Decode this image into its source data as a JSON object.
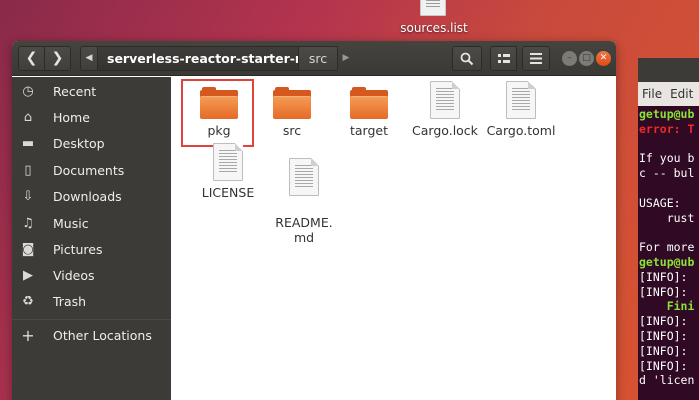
{
  "desktop": {
    "file_label": "sources.list"
  },
  "terminal": {
    "menu": [
      "File",
      "Edit"
    ],
    "lines": [
      {
        "text": "getup@ub",
        "style": "green"
      },
      {
        "text": "error: T",
        "style": "red"
      },
      {
        "text": "",
        "style": ""
      },
      {
        "text": "If you b",
        "style": ""
      },
      {
        "text": "c -- bul",
        "style": ""
      },
      {
        "text": "",
        "style": ""
      },
      {
        "text": "USAGE:",
        "style": ""
      },
      {
        "text": "    rust",
        "style": ""
      },
      {
        "text": "",
        "style": ""
      },
      {
        "text": "For more",
        "style": ""
      },
      {
        "text": "getup@ub",
        "style": "green"
      },
      {
        "text": "[INFO]: ",
        "style": ""
      },
      {
        "text": "[INFO]: ",
        "style": ""
      },
      {
        "text": "    Fini",
        "style": "green"
      },
      {
        "text": "[INFO]: ",
        "style": ""
      },
      {
        "text": "[INFO]: ",
        "style": ""
      },
      {
        "text": "[INFO]: ",
        "style": ""
      },
      {
        "text": "[INFO]: ",
        "style": ""
      },
      {
        "text": "d 'licen",
        "style": ""
      }
    ]
  },
  "files": {
    "path": {
      "current": "serverless-reactor-starter-main",
      "child": "src"
    },
    "sidebar": [
      {
        "label": "Recent",
        "icon": "clock-icon",
        "glyph": "◷"
      },
      {
        "label": "Home",
        "icon": "home-icon",
        "glyph": "⌂"
      },
      {
        "label": "Desktop",
        "icon": "folder-icon",
        "glyph": "▬"
      },
      {
        "label": "Documents",
        "icon": "document-icon",
        "glyph": "▯"
      },
      {
        "label": "Downloads",
        "icon": "download-icon",
        "glyph": "⇩"
      },
      {
        "label": "Music",
        "icon": "music-icon",
        "glyph": "♫"
      },
      {
        "label": "Pictures",
        "icon": "camera-icon",
        "glyph": "◙"
      },
      {
        "label": "Videos",
        "icon": "video-icon",
        "glyph": "▶"
      },
      {
        "label": "Trash",
        "icon": "trash-icon",
        "glyph": "♻"
      },
      {
        "label": "Other Locations",
        "icon": "plus-icon",
        "glyph": "+"
      }
    ],
    "items": [
      {
        "label": "pkg",
        "kind": "folder"
      },
      {
        "label": "src",
        "kind": "folder"
      },
      {
        "label": "target",
        "kind": "folder"
      },
      {
        "label": "Cargo.lock",
        "kind": "file"
      },
      {
        "label": "Cargo.toml",
        "kind": "file"
      },
      {
        "label": "LICENSE",
        "kind": "file"
      },
      {
        "label": "README.\nmd",
        "kind": "file"
      }
    ]
  }
}
